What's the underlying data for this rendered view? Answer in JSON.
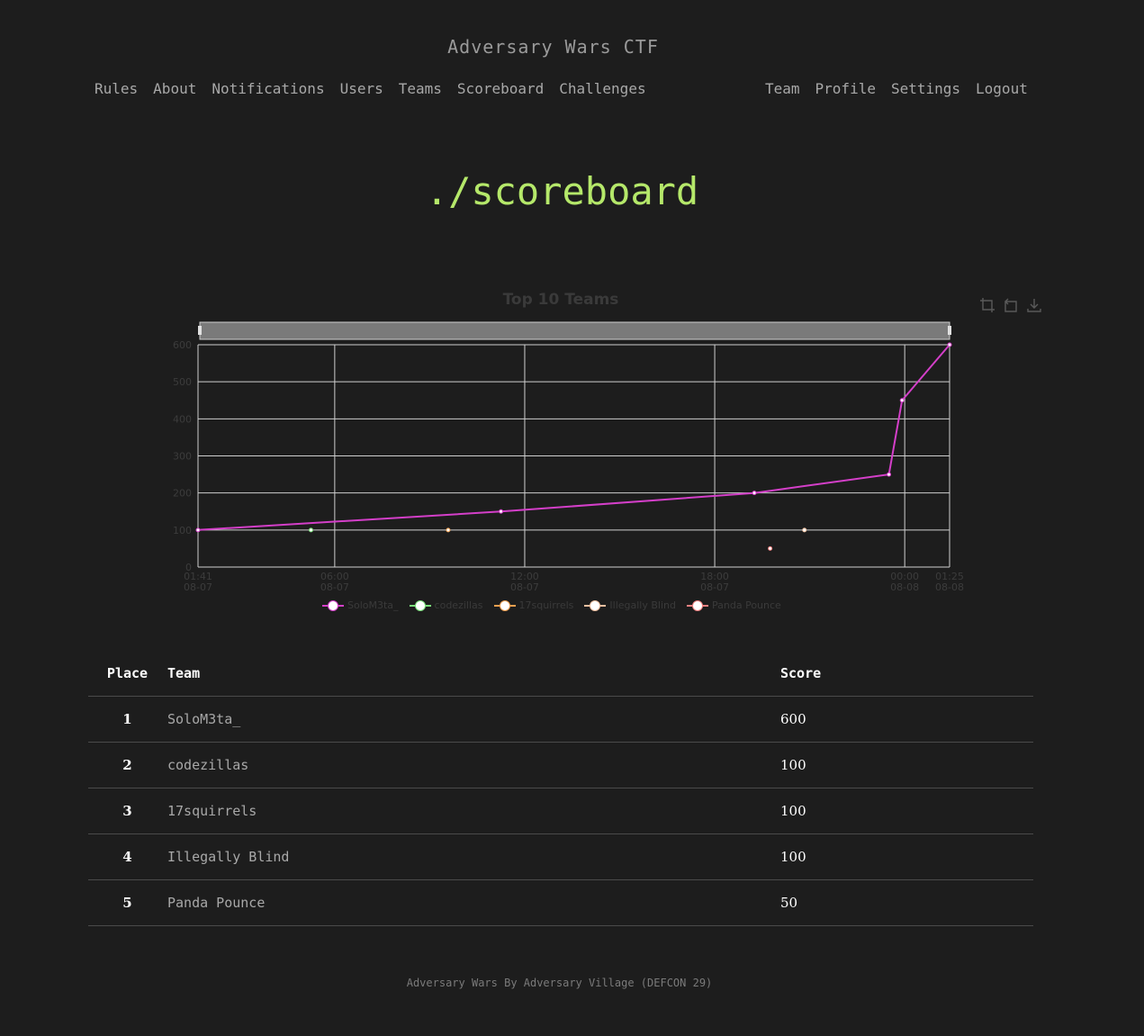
{
  "header": {
    "brand": "Adversary Wars CTF",
    "nav_left": [
      "Rules",
      "About",
      "Notifications",
      "Users",
      "Teams",
      "Scoreboard",
      "Challenges"
    ],
    "nav_right": [
      "Team",
      "Profile",
      "Settings",
      "Logout"
    ]
  },
  "page_title": "./scoreboard",
  "toolbox_icons": [
    "zoom-icon",
    "restore-icon",
    "download-icon"
  ],
  "chart_data": {
    "type": "line",
    "title": "Top 10 Teams",
    "ylim": [
      0,
      600
    ],
    "y_ticks": [
      0,
      100,
      200,
      300,
      400,
      500,
      600
    ],
    "x_range": [
      "08-07 01:41",
      "08-08 01:25"
    ],
    "x_ticks": [
      {
        "time": "08-07 01:41",
        "l1": "01:41",
        "l2": "08-07"
      },
      {
        "time": "08-07 06:00",
        "l1": "06:00",
        "l2": "08-07"
      },
      {
        "time": "08-07 12:00",
        "l1": "12:00",
        "l2": "08-07"
      },
      {
        "time": "08-07 18:00",
        "l1": "18:00",
        "l2": "08-07"
      },
      {
        "time": "08-08 00:00",
        "l1": "00:00",
        "l2": "08-08"
      },
      {
        "time": "08-08 01:25",
        "l1": "01:25",
        "l2": "08-08"
      }
    ],
    "grid": true,
    "legend_position": "bottom",
    "series": [
      {
        "name": "SoloM3ta_",
        "color": "#d43fc9",
        "points": [
          [
            "08-07 01:41",
            100
          ],
          [
            "08-07 11:15",
            150
          ],
          [
            "08-07 19:15",
            200
          ],
          [
            "08-07 23:30",
            250
          ],
          [
            "08-07 23:55",
            450
          ],
          [
            "08-08 01:25",
            600
          ]
        ]
      },
      {
        "name": "codezillas",
        "color": "#7be07b",
        "points": [
          [
            "08-07 05:15",
            100
          ]
        ]
      },
      {
        "name": "17squirrels",
        "color": "#f0a050",
        "points": [
          [
            "08-07 09:35",
            100
          ]
        ]
      },
      {
        "name": "Illegally Blind",
        "color": "#f0c0a0",
        "points": [
          [
            "08-07 20:50",
            100
          ]
        ]
      },
      {
        "name": "Panda Pounce",
        "color": "#f08080",
        "points": [
          [
            "08-07 19:45",
            50
          ]
        ]
      }
    ]
  },
  "table": {
    "headers": [
      "Place",
      "Team",
      "Score"
    ],
    "rows": [
      {
        "place": "1",
        "team": "SoloM3ta_",
        "score": "600"
      },
      {
        "place": "2",
        "team": "codezillas",
        "score": "100"
      },
      {
        "place": "3",
        "team": "17squirrels",
        "score": "100"
      },
      {
        "place": "4",
        "team": "Illegally Blind",
        "score": "100"
      },
      {
        "place": "5",
        "team": "Panda Pounce",
        "score": "50"
      }
    ]
  },
  "footer": "Adversary Wars By Adversary Village (DEFCON 29)"
}
